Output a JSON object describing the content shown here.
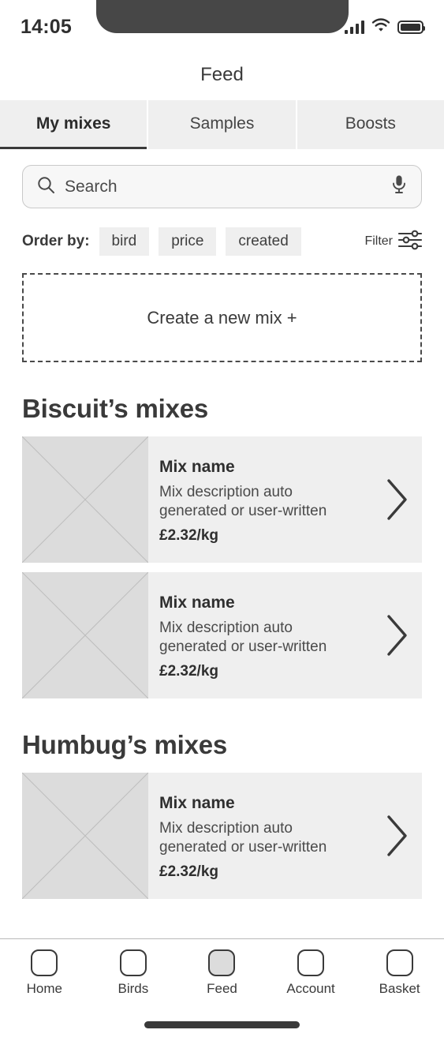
{
  "status_bar": {
    "time": "14:05",
    "cellular_icon": "cellular-signal-icon",
    "wifi_icon": "wifi-icon",
    "battery_icon": "battery-full-icon"
  },
  "header": {
    "title": "Feed"
  },
  "tabs": [
    {
      "label": "My mixes",
      "active": true
    },
    {
      "label": "Samples",
      "active": false
    },
    {
      "label": "Boosts",
      "active": false
    }
  ],
  "search": {
    "placeholder": "Search",
    "value": "",
    "search_icon": "search-icon",
    "mic_icon": "microphone-icon"
  },
  "order_by": {
    "label": "Order by:",
    "chips": [
      "bird",
      "price",
      "created"
    ],
    "filter_label": "Filter",
    "filter_icon": "sliders-icon"
  },
  "create_mix": {
    "label": "Create a new mix +"
  },
  "sections": [
    {
      "title": "Biscuit’s mixes",
      "mixes": [
        {
          "name": "Mix name",
          "description": "Mix description auto generated or user-written",
          "price": "£2.32/kg",
          "thumbnail": "image-placeholder",
          "chevron": "chevron-right-icon"
        },
        {
          "name": "Mix name",
          "description": "Mix description auto generated or user-written",
          "price": "£2.32/kg",
          "thumbnail": "image-placeholder",
          "chevron": "chevron-right-icon"
        }
      ]
    },
    {
      "title": "Humbug’s mixes",
      "mixes": [
        {
          "name": "Mix name",
          "description": "Mix description auto generated or user-written",
          "price": "£2.32/kg",
          "thumbnail": "image-placeholder",
          "chevron": "chevron-right-icon"
        }
      ]
    }
  ],
  "bottom_nav": [
    {
      "label": "Home",
      "icon": "home-icon",
      "active": false
    },
    {
      "label": "Birds",
      "icon": "birds-icon",
      "active": false
    },
    {
      "label": "Feed",
      "icon": "feed-icon",
      "active": true
    },
    {
      "label": "Account",
      "icon": "account-icon",
      "active": false
    },
    {
      "label": "Basket",
      "icon": "basket-icon",
      "active": false
    }
  ],
  "colors": {
    "background": "#ffffff",
    "card_gray": "#efefef",
    "thumb_gray": "#dcdcdc",
    "text_dark": "#3a3a3a",
    "notch": "#474747"
  }
}
